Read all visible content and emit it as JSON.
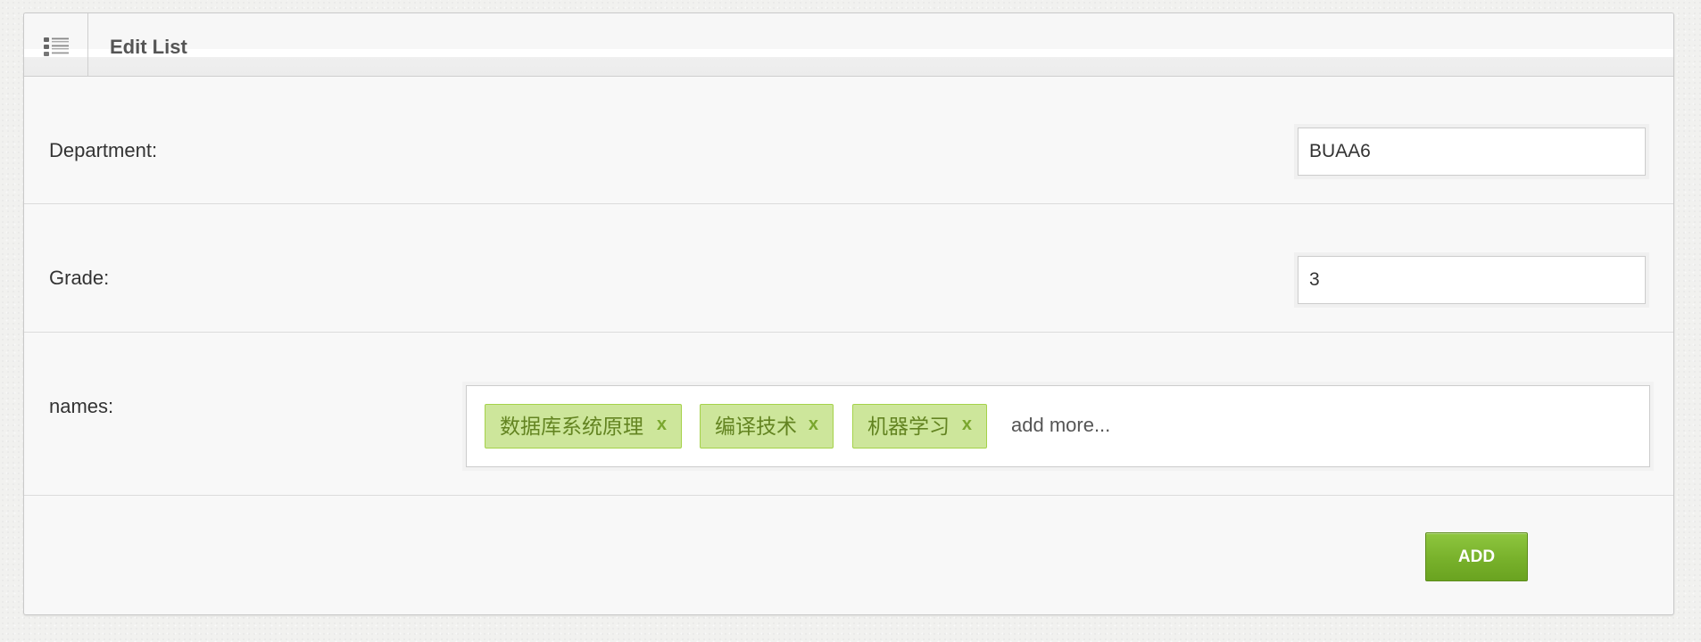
{
  "header": {
    "icon": "list-icon",
    "title": "Edit List"
  },
  "form": {
    "department": {
      "label": "Department:",
      "value": "BUAA6"
    },
    "grade": {
      "label": "Grade:",
      "value": "3"
    },
    "names": {
      "label": "names:",
      "tags": [
        {
          "text": "数据库系统原理",
          "remove": "x"
        },
        {
          "text": "编译技术",
          "remove": "x"
        },
        {
          "text": "机器学习",
          "remove": "x"
        }
      ],
      "placeholder": "add more..."
    }
  },
  "actions": {
    "add_label": "ADD"
  },
  "colors": {
    "tag_background": "#cde69b",
    "tag_border": "#a5d24a",
    "tag_text": "#638421",
    "button_green": "#78b12b"
  }
}
